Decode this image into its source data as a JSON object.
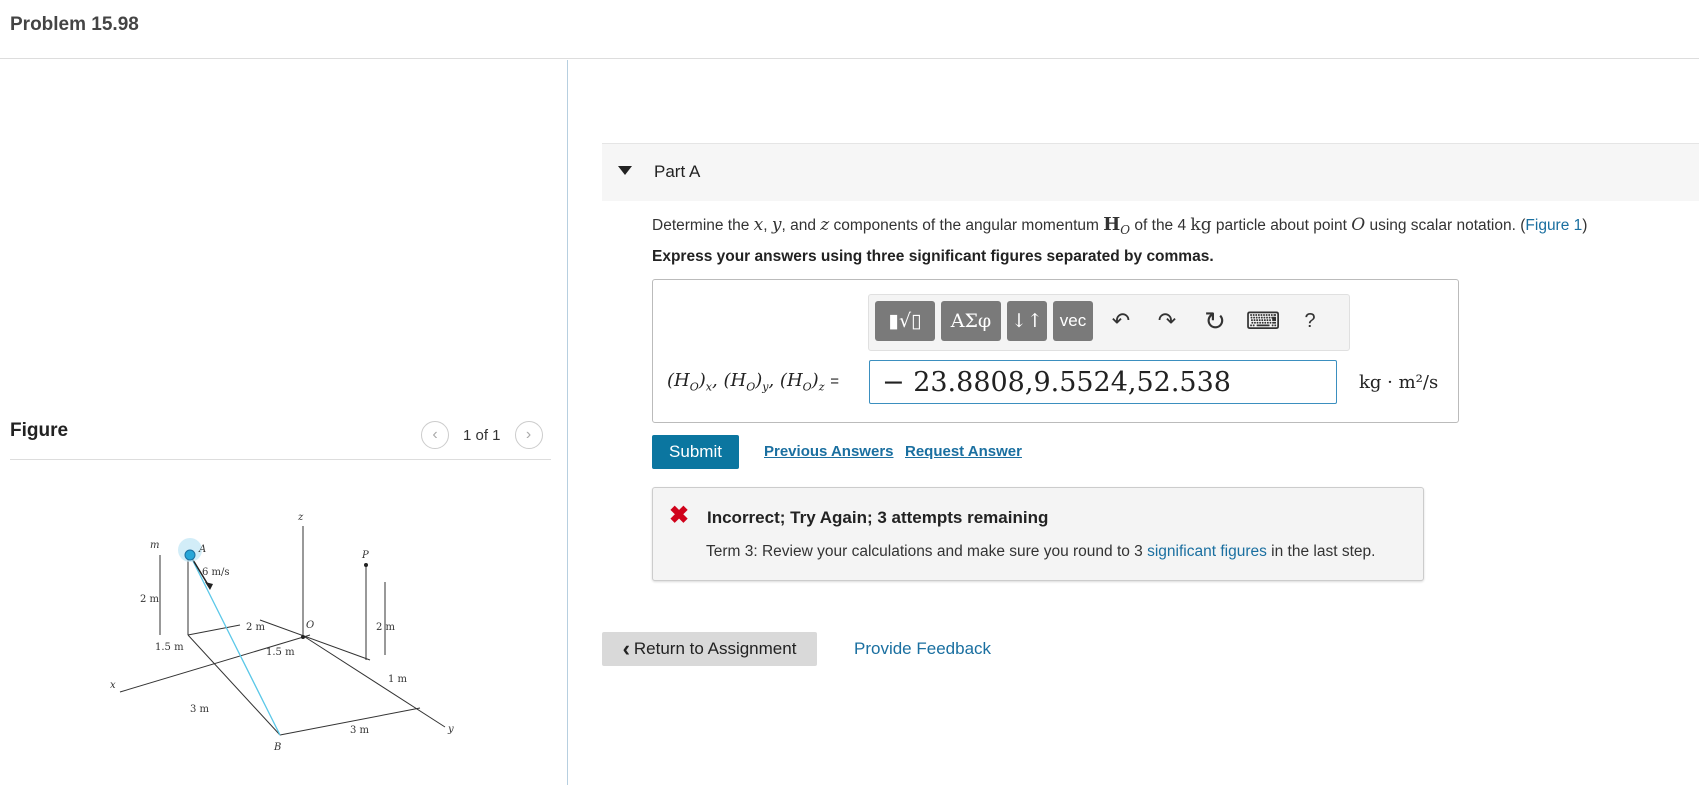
{
  "header": {
    "title": "Problem 15.98"
  },
  "figure_panel": {
    "label": "Figure",
    "counter": "1 of 1",
    "prev_icon": "‹",
    "next_icon": "›",
    "diagram": {
      "labels": {
        "m": "m",
        "A": "A",
        "velocity": "6 m/s",
        "z": "z",
        "O": "O",
        "P": "P",
        "x": "x",
        "y": "y",
        "B": "B",
        "d_2m_left": "2 m",
        "d_15m_left": "1.5 m",
        "d_2m_mid": "2 m",
        "d_15m_mid": "1.5 m",
        "d_2m_right": "2 m",
        "d_1m": "1 m",
        "d_3m_left": "3 m",
        "d_3m_bottom": "3 m"
      }
    }
  },
  "part_a": {
    "label": "Part A",
    "question": {
      "pre": "Determine the ",
      "x": "x",
      "sep1": ", ",
      "y": "y",
      "sep2": ", and ",
      "z": "z",
      "mid": " components of the angular momentum ",
      "H": "H",
      "Hsub": "O",
      "mid2": " of the 4 ",
      "kg": "kg",
      "mid3": " particle about point ",
      "O": "O",
      "post": " using scalar notation. (",
      "link": "Figure 1",
      "close": ")"
    },
    "instruction": "Express your answers using three significant figures separated by commas.",
    "toolbar": {
      "templates": "▮√▯",
      "greek": "ΑΣφ",
      "arrows": "↓↑",
      "vec": "vec",
      "undo": "↶",
      "redo": "↷",
      "reset": "↻",
      "keyboard": "⌨",
      "help": "?"
    },
    "equation_label": "(H",
    "equation_parts": [
      "(H_O)_x",
      "(H_O)_y",
      "(H_O)_z"
    ],
    "equals": "=",
    "answer_value": "− 23.8808,9.5524,52.538",
    "units": "kg · m²/s",
    "submit": "Submit",
    "previous_answers": "Previous Answers",
    "request_answer": "Request Answer",
    "feedback": {
      "icon": "✖",
      "heading": "Incorrect; Try Again; 3 attempts remaining",
      "message_pre": "Term 3: Review your calculations and make sure you round to 3 ",
      "message_link": "significant figures",
      "message_post": " in the last step."
    }
  },
  "footer": {
    "return": "Return to Assignment",
    "return_icon": "‹",
    "provide_feedback": "Provide Feedback"
  }
}
